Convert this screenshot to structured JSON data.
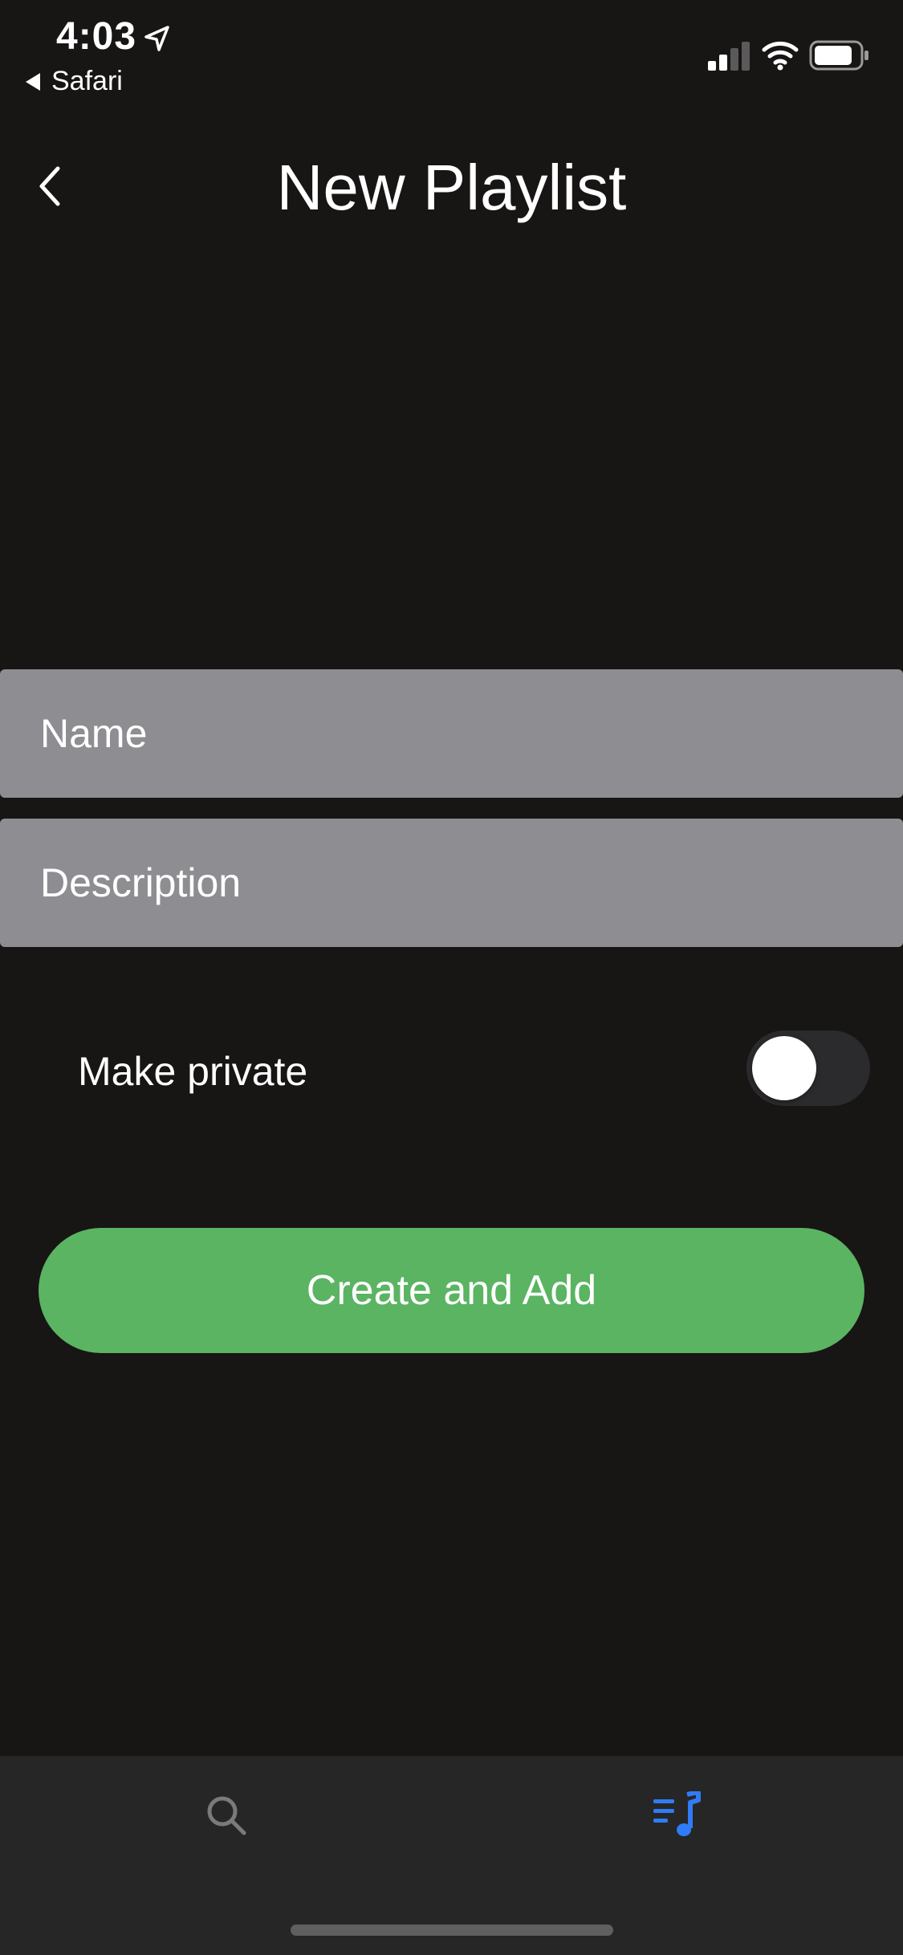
{
  "status_bar": {
    "time": "4:03",
    "back_app": "Safari"
  },
  "header": {
    "title": "New Playlist"
  },
  "form": {
    "name_placeholder": "Name",
    "description_placeholder": "Description",
    "private_label": "Make private",
    "private_enabled": false,
    "submit_label": "Create and Add"
  },
  "tab_bar": {
    "tabs": [
      {
        "icon": "search-icon",
        "active": false
      },
      {
        "icon": "playlist-music-icon",
        "active": true
      }
    ]
  },
  "colors": {
    "background": "#181515",
    "field": "#8e8d92",
    "accent_green": "#5ab462",
    "active_tab_blue": "#2f7cf6",
    "inactive_tab_gray": "#7a7a7a",
    "tab_bar": "#262626"
  }
}
